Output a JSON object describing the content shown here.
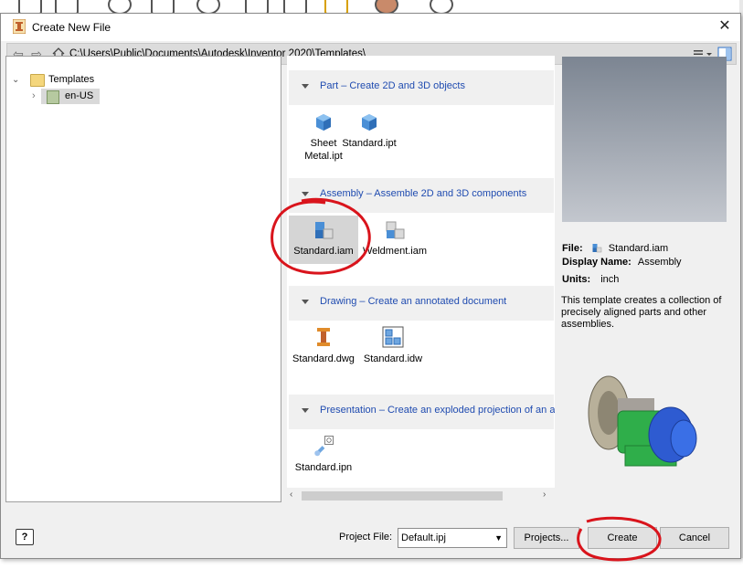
{
  "window": {
    "title": "Create New File",
    "close_label": "✕",
    "path": "C:\\Users\\Public\\Documents\\Autodesk\\Inventor 2020\\Templates\\"
  },
  "tree": {
    "root": "Templates",
    "child": "en-US"
  },
  "sections": [
    {
      "label": "Part – Create 2D and 3D objects",
      "items": [
        "Sheet Metal.ipt",
        "Standard.ipt"
      ]
    },
    {
      "label": "Assembly – Assemble 2D and 3D components",
      "items": [
        "Standard.iam",
        "Weldment.iam"
      ]
    },
    {
      "label": "Drawing – Create an annotated document",
      "items": [
        "Standard.dwg",
        "Standard.idw"
      ]
    },
    {
      "label": "Presentation – Create an exploded projection of an a",
      "items": [
        "Standard.ipn"
      ]
    }
  ],
  "tile_labels": {
    "sheet_metal_line1": "Sheet",
    "sheet_metal_line2": "Metal.ipt"
  },
  "details": {
    "file_label": "File:",
    "file_value": "Standard.iam",
    "display_name_label": "Display Name:",
    "display_name_value": "Assembly",
    "units_label": "Units:",
    "units_value": "inch",
    "description": "This template creates a collection of precisely aligned parts and other assemblies."
  },
  "footer": {
    "help_label": "?",
    "project_file_label": "Project File:",
    "project_file_value": "Default.ipj",
    "projects_button": "Projects...",
    "create_button": "Create",
    "cancel_button": "Cancel"
  },
  "colors": {
    "section_link": "#1f4bb0",
    "annotation_red": "#d9141c",
    "part_blue": "#4a8fd6"
  }
}
